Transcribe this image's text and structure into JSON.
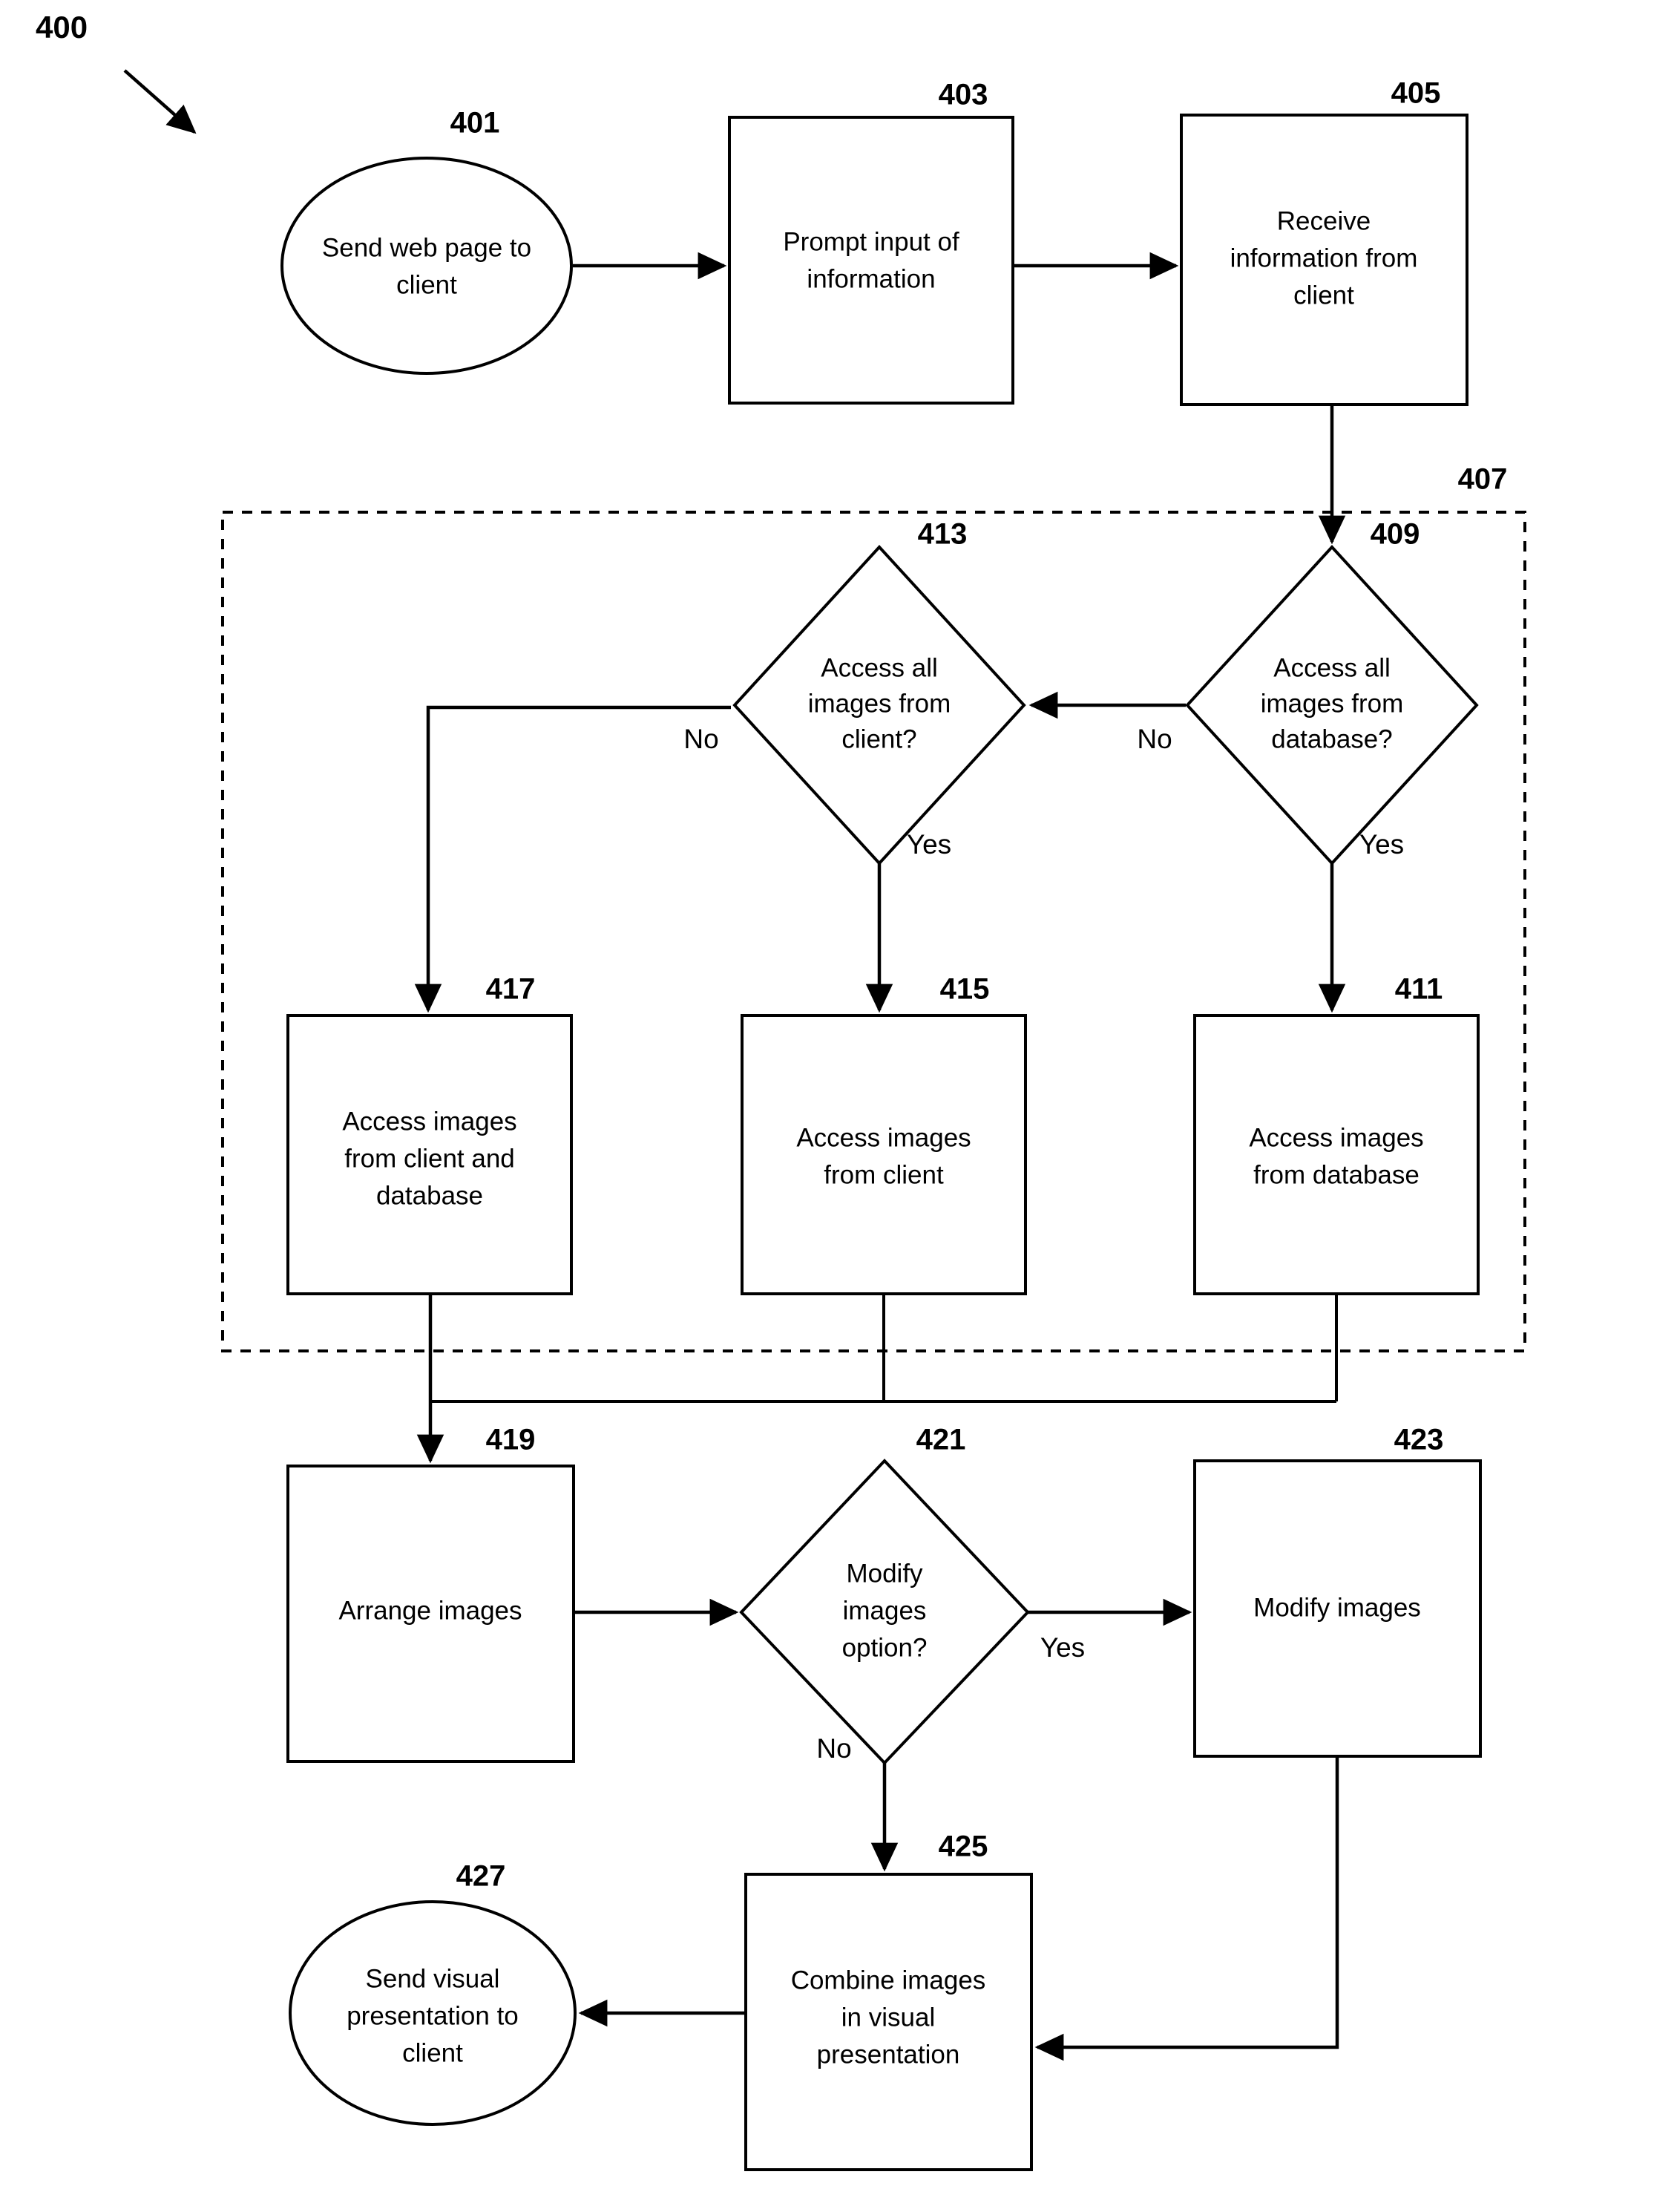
{
  "figure": {
    "label": "400"
  },
  "nodes": [
    {
      "ref": "401",
      "shape": "ellipse",
      "lines": [
        "Send web page to",
        "client"
      ]
    },
    {
      "ref": "403",
      "shape": "process",
      "lines": [
        "Prompt input of",
        "information"
      ]
    },
    {
      "ref": "405",
      "shape": "process",
      "lines": [
        "Receive",
        "information from",
        "client"
      ]
    },
    {
      "ref": "407",
      "shape": "group",
      "lines": []
    },
    {
      "ref": "409",
      "shape": "decision",
      "lines": [
        "Access all",
        "images from",
        "database?"
      ]
    },
    {
      "ref": "411",
      "shape": "process",
      "lines": [
        "Access images",
        "from database"
      ]
    },
    {
      "ref": "413",
      "shape": "decision",
      "lines": [
        "Access all",
        "images from",
        "client?"
      ]
    },
    {
      "ref": "415",
      "shape": "process",
      "lines": [
        "Access images",
        "from client"
      ]
    },
    {
      "ref": "417",
      "shape": "process",
      "lines": [
        "Access images",
        "from client and",
        "database"
      ]
    },
    {
      "ref": "419",
      "shape": "process",
      "lines": [
        "Arrange images"
      ]
    },
    {
      "ref": "421",
      "shape": "decision",
      "lines": [
        "Modify",
        "images",
        "option?"
      ]
    },
    {
      "ref": "423",
      "shape": "process",
      "lines": [
        "Modify images"
      ]
    },
    {
      "ref": "425",
      "shape": "process",
      "lines": [
        "Combine images",
        "in visual",
        "presentation"
      ]
    },
    {
      "ref": "427",
      "shape": "ellipse",
      "lines": [
        "Send visual",
        "presentation to",
        "client"
      ]
    }
  ],
  "edge_labels": {
    "d409_no": "No",
    "d409_yes": "Yes",
    "d413_no": "No",
    "d413_yes": "Yes",
    "d421_yes": "Yes",
    "d421_no": "No"
  },
  "colors": {
    "stroke": "#000000",
    "fill": "#ffffff"
  }
}
